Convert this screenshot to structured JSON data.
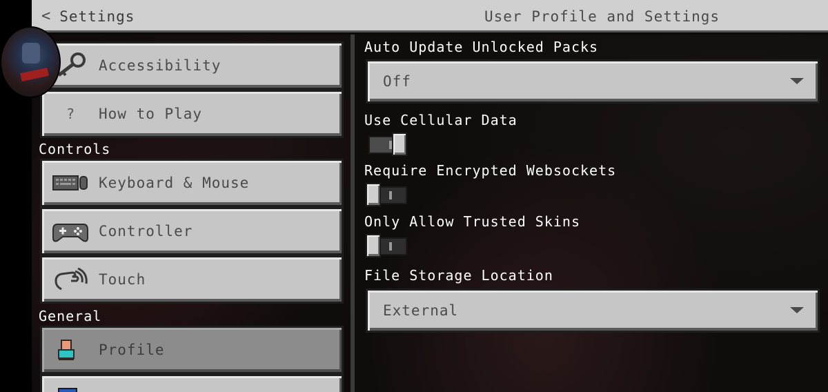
{
  "header": {
    "back_label": "Settings",
    "title": "User Profile and Settings"
  },
  "sidebar": {
    "items": [
      {
        "label": "Accessibility",
        "icon": "key-icon"
      },
      {
        "label": "How to Play",
        "icon": "question-icon",
        "icon_glyph": "?"
      },
      {
        "label": "Keyboard & Mouse",
        "icon": "keyboard-mouse-icon"
      },
      {
        "label": "Controller",
        "icon": "gamepad-icon"
      },
      {
        "label": "Touch",
        "icon": "touch-hand-icon"
      },
      {
        "label": "Profile",
        "icon": "profile-icon",
        "selected": true
      },
      {
        "label": "",
        "icon": "monitor-icon"
      }
    ],
    "sections": {
      "controls": "Controls",
      "general": "General"
    }
  },
  "settings": {
    "auto_update": {
      "label": "Auto Update Unlocked Packs",
      "value": "Off"
    },
    "cellular": {
      "label": "Use Cellular Data",
      "on": true
    },
    "encrypted_ws": {
      "label": "Require Encrypted Websockets",
      "on": false
    },
    "trusted_skins": {
      "label": "Only Allow Trusted Skins",
      "on": false
    },
    "file_storage": {
      "label": "File Storage Location",
      "value": "External"
    }
  },
  "colors": {
    "button_bg": "#c6c6c6",
    "button_selected_bg": "#8c8c8c",
    "profile_icon_top": "#e89a78",
    "profile_icon_bottom": "#2ec4c4"
  }
}
